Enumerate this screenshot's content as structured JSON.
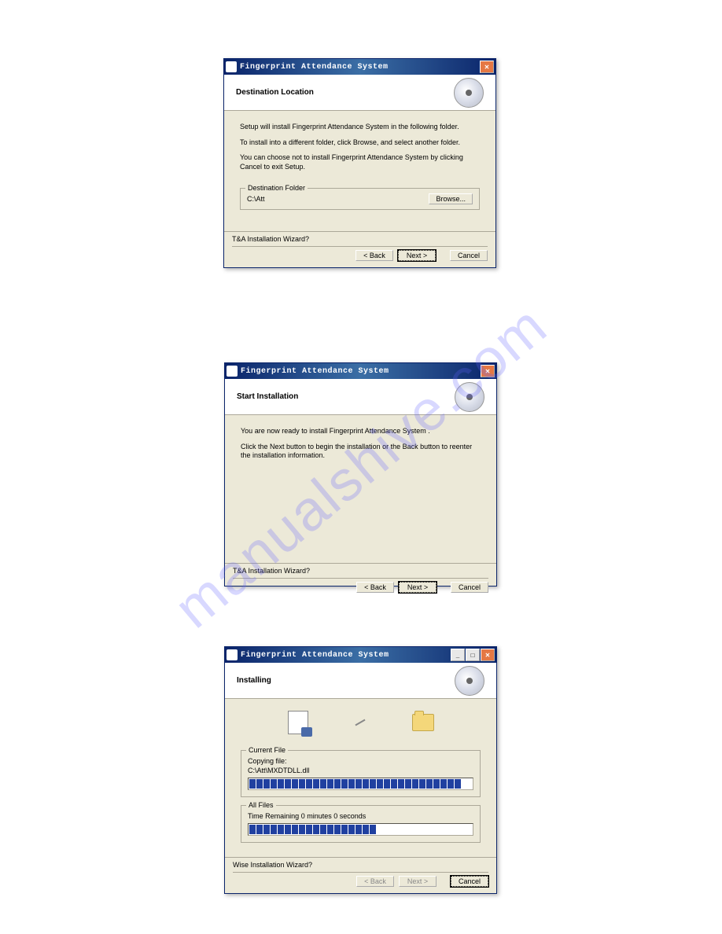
{
  "watermark": "manualshive.com",
  "dialog1": {
    "title": "Fingerprint Attendance System",
    "header": "Destination Location",
    "line1": "Setup will install Fingerprint Attendance System  in the following folder.",
    "line2": "To install into a different folder, click Browse, and select another folder.",
    "line3": "You can choose not to install Fingerprint Attendance System  by clicking Cancel to exit Setup.",
    "destFolderLegend": "Destination Folder",
    "destPath": "C:\\Att",
    "browseLabel": "Browse...",
    "footerLabel": "T&A Installation Wizard?",
    "backLabel": "< Back",
    "nextLabel": "Next >",
    "cancelLabel": "Cancel"
  },
  "dialog2": {
    "title": "Fingerprint Attendance System",
    "header": "Start Installation",
    "line1": "You are now ready to install Fingerprint Attendance System .",
    "line2": "Click the Next button to begin the installation or the Back button to reenter the installation information.",
    "footerLabel": "T&A Installation Wizard?",
    "backLabel": "< Back",
    "nextLabel": "Next >",
    "cancelLabel": "Cancel"
  },
  "dialog3": {
    "title": "Fingerprint Attendance System",
    "header": "Installing",
    "currentFileLegend": "Current File",
    "copyingLabel": "Copying file:",
    "copyingPath": "C:\\Att\\MXDTDLL.dll",
    "allFilesLegend": "All Files",
    "timeRemaining": "Time Remaining 0 minutes 0 seconds",
    "footerLabel": "Wise Installation Wizard?",
    "backLabel": "< Back",
    "nextLabel": "Next >",
    "cancelLabel": "Cancel",
    "progress1": 30,
    "progress2": 18
  }
}
